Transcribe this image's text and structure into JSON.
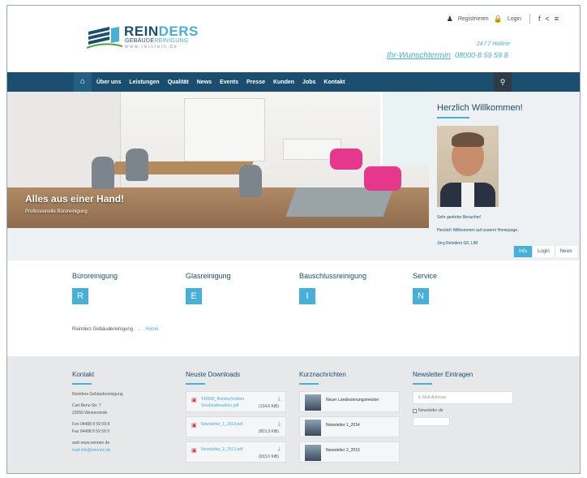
{
  "header": {
    "logo": {
      "brand_a": "REIN",
      "brand_b": "DERS",
      "sub_a": "GEBÄUDE",
      "sub_b": "REINIGUNG",
      "url": "www.reinrein.de"
    },
    "topbar": {
      "register": "Registrieren",
      "login": "Login"
    },
    "hotline": "24 / 7 Hotline",
    "wunsch_link": "Ihr-Wunschtermin",
    "phone": "08000-8 59 59 8"
  },
  "nav": {
    "items": [
      "Über uns",
      "Leistungen",
      "Qualität",
      "News",
      "Events",
      "Presse",
      "Kunden",
      "Jobs",
      "Kontakt"
    ]
  },
  "hero": {
    "title": "Alles aus einer Hand!",
    "subtitle": "Professionelle Büroreinigung"
  },
  "welcome": {
    "title": "Herzlich Willkommen!",
    "line1": "Sehr geehrter Besucher!",
    "line2": "Herzlich Willkommen auf unserer Homepage.",
    "line3": "Jörg Reinders GF, LIM",
    "tabs": [
      "Info",
      "Login",
      "News"
    ]
  },
  "services": [
    {
      "title": "Büroreinigung",
      "letter": "R"
    },
    {
      "title": "Glasreinigung",
      "letter": "E"
    },
    {
      "title": "Bauschlussreinigung",
      "letter": "I"
    },
    {
      "title": "Service",
      "letter": "N"
    }
  ],
  "breadcrumb": {
    "site": "Reinders Gebäudereinigung",
    "arrow": "→",
    "home": "Home"
  },
  "footer": {
    "kontakt": {
      "title": "Kontakt",
      "name": "Reinders Gebäudereinigung",
      "street": "Carl-Benz-Str. 7",
      "city": "22650 Westerstede",
      "fon": "Fon 04488 8 59 59 8",
      "fax": "Fax 04488 8 59 59 9",
      "web": "web www.reinrein.de",
      "mail": "mail info@reinrein.de"
    },
    "downloads": {
      "title": "Neuste Downloads",
      "items": [
        {
          "name": "140826_Rundschreiben Vorstandswahlen.pdf",
          "size": "(134,6 KiB)"
        },
        {
          "name": "Newsletter_1_2014.pdf",
          "size": "(815,3 KiB)"
        },
        {
          "name": "Newsletter_2_2013.pdf",
          "size": "(933,0 KiB)"
        }
      ]
    },
    "news": {
      "title": "Kurznachrichten",
      "items": [
        "Neuer Landesinnungsmeister",
        "Newsletter 1_2014",
        "Newsletter 2_2013"
      ]
    },
    "newsletter": {
      "title": "Newsletter Eintragen",
      "placeholder": "E-Mail-Adresse",
      "checkbox_label": "Newsletter de"
    }
  },
  "colors": {
    "primary": "#1b4e6e",
    "accent": "#47b0d8"
  }
}
